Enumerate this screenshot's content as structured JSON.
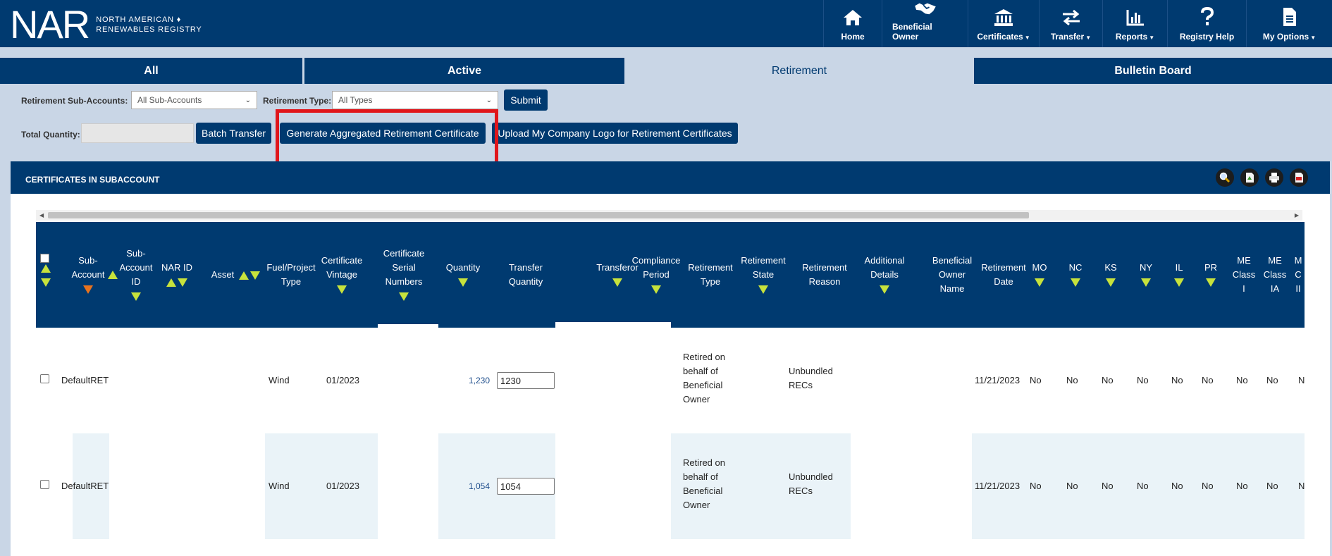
{
  "header": {
    "logo_mark": "NAR",
    "logo_line1": "NORTH AMERICAN ♦",
    "logo_line2": "RENEWABLES REGISTRY",
    "nav": [
      {
        "label": "Home",
        "icon": "home-icon",
        "caret": false
      },
      {
        "label": "Beneficial Owner",
        "icon": "handshake-icon",
        "caret": false
      },
      {
        "label": "Certificates",
        "icon": "bank-icon",
        "caret": true
      },
      {
        "label": "Transfer",
        "icon": "transfer-arrows-icon",
        "caret": true
      },
      {
        "label": "Reports",
        "icon": "bar-chart-icon",
        "caret": true
      },
      {
        "label": "Registry Help",
        "icon": "question-icon",
        "caret": false
      },
      {
        "label": "My Options",
        "icon": "document-icon",
        "caret": true
      }
    ]
  },
  "tabs": [
    {
      "label": "All",
      "active": false
    },
    {
      "label": "Active",
      "active": false
    },
    {
      "label": "Retirement",
      "active": true
    },
    {
      "label": "Bulletin Board",
      "active": false
    }
  ],
  "filters": {
    "subaccounts_label": "Retirement Sub-Accounts:",
    "subaccounts_value": "All Sub-Accounts",
    "type_label": "Retirement Type:",
    "type_value": "All Types",
    "submit": "Submit",
    "total_quantity_label": "Total Quantity:",
    "total_quantity_value": "",
    "batch_transfer": "Batch Transfer",
    "generate_certificate": "Generate Aggregated Retirement Certificate",
    "upload_logo": "Upload My Company Logo for Retirement Certificates"
  },
  "panel": {
    "title": "CERTIFICATES IN SUBACCOUNT",
    "tools": [
      "magnifier-icon",
      "export-excel-icon",
      "print-icon",
      "pdf-icon"
    ]
  },
  "table": {
    "columns": [
      {
        "label": "Sub-\nAccount"
      },
      {
        "label": "Sub-\nAccount\nID"
      },
      {
        "label": "NAR ID"
      },
      {
        "label": "Asset"
      },
      {
        "label": "Fuel/Project\nType"
      },
      {
        "label": "Certificate\nVintage"
      },
      {
        "label": "Certificate\nSerial\nNumbers"
      },
      {
        "label": "Quantity"
      },
      {
        "label": "Transfer\nQuantity"
      },
      {
        "label": "Transferor"
      },
      {
        "label": "Compliance\nPeriod"
      },
      {
        "label": "Retirement\nType"
      },
      {
        "label": "Retirement\nState"
      },
      {
        "label": "Retirement\nReason"
      },
      {
        "label": "Additional\nDetails"
      },
      {
        "label": "Beneficial\nOwner\nName"
      },
      {
        "label": "Retirement\nDate"
      },
      {
        "label": "MO"
      },
      {
        "label": "NC"
      },
      {
        "label": "KS"
      },
      {
        "label": "NY"
      },
      {
        "label": "IL"
      },
      {
        "label": "PR"
      },
      {
        "label": "ME\nClass\nI"
      },
      {
        "label": "ME\nClass\nIA"
      },
      {
        "label": "M\nC\nII"
      }
    ],
    "rows": [
      {
        "sub_account": "DefaultRET",
        "fuel": "Wind",
        "vintage": "01/2023",
        "quantity": "1,230",
        "transfer_quantity": "1230",
        "retirement_type": "Retired on\nbehalf of\nBeneficial\nOwner",
        "retirement_reason": "Unbundled\nRECs",
        "retirement_date": "11/21/2023",
        "mo": "No",
        "nc": "No",
        "ks": "No",
        "ny": "No",
        "il": "No",
        "pr": "No",
        "me1": "No",
        "me1a": "No",
        "me2": "N"
      },
      {
        "sub_account": "DefaultRET",
        "fuel": "Wind",
        "vintage": "01/2023",
        "quantity": "1,054",
        "transfer_quantity": "1054",
        "retirement_type": "Retired on\nbehalf of\nBeneficial\nOwner",
        "retirement_reason": "Unbundled\nRECs",
        "retirement_date": "11/21/2023",
        "mo": "No",
        "nc": "No",
        "ks": "No",
        "ny": "No",
        "il": "No",
        "pr": "No",
        "me1": "No",
        "me1a": "No",
        "me2": "N"
      }
    ]
  }
}
